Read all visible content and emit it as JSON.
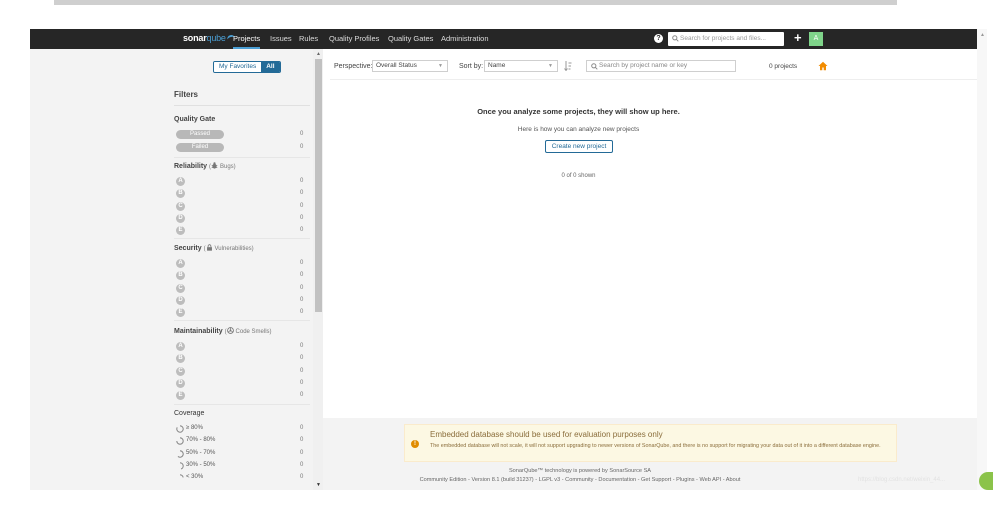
{
  "nav": {
    "logo_sonar": "sonar",
    "logo_qube": "qube",
    "items": [
      {
        "label": "Projects",
        "active": true
      },
      {
        "label": "Issues"
      },
      {
        "label": "Rules"
      },
      {
        "label": "Quality Profiles"
      },
      {
        "label": "Quality Gates"
      },
      {
        "label": "Administration"
      }
    ],
    "help_glyph": "?",
    "search_placeholder": "Search for projects and files...",
    "plus_glyph": "+",
    "avatar_letter": "A",
    "accent": "#4b9fd5",
    "avatar_color": "#7fd48a"
  },
  "sidebar": {
    "favorites": {
      "my": "My Favorites",
      "all": "All"
    },
    "filters_title": "Filters",
    "quality_gate": {
      "title": "Quality Gate",
      "items": [
        {
          "label": "Passed",
          "count": "0"
        },
        {
          "label": "Failed",
          "count": "0"
        }
      ]
    },
    "reliability": {
      "title": "Reliability",
      "open": "(",
      "icon": "bug-icon",
      "sub": "Bugs",
      "close": ")",
      "items": [
        {
          "label": "A",
          "count": "0"
        },
        {
          "label": "B",
          "count": "0"
        },
        {
          "label": "C",
          "count": "0"
        },
        {
          "label": "D",
          "count": "0"
        },
        {
          "label": "E",
          "count": "0"
        }
      ]
    },
    "security": {
      "title": "Security",
      "open": "(",
      "icon": "lock-icon",
      "sub": "Vulnerabilities",
      "close": ")",
      "items": [
        {
          "label": "A",
          "count": "0"
        },
        {
          "label": "B",
          "count": "0"
        },
        {
          "label": "C",
          "count": "0"
        },
        {
          "label": "D",
          "count": "0"
        },
        {
          "label": "E",
          "count": "0"
        }
      ]
    },
    "maintainability": {
      "title": "Maintainability",
      "open": "(",
      "icon": "code-smell-icon",
      "sub": "Code Smells",
      "close": ")",
      "items": [
        {
          "label": "A",
          "count": "0"
        },
        {
          "label": "B",
          "count": "0"
        },
        {
          "label": "C",
          "count": "0"
        },
        {
          "label": "D",
          "count": "0"
        },
        {
          "label": "E",
          "count": "0"
        }
      ]
    },
    "coverage": {
      "title": "Coverage",
      "items": [
        {
          "label": "≥ 80%",
          "count": "0"
        },
        {
          "label": "70% - 80%",
          "count": "0"
        },
        {
          "label": "50% - 70%",
          "count": "0"
        },
        {
          "label": "30% - 50%",
          "count": "0"
        },
        {
          "label": "< 30%",
          "count": "0"
        }
      ]
    }
  },
  "toolbar": {
    "perspective_label": "Perspective:",
    "perspective_value": "Overall Status",
    "sortby_label": "Sort by:",
    "sortby_value": "Name",
    "search_placeholder": "Search by project name or key",
    "projects_count": "0 projects",
    "home_color": "#f28c00"
  },
  "main": {
    "empty_title": "Once you analyze some projects, they will show up here.",
    "empty_sub": "Here is how you can analyze new projects",
    "create_button": "Create new project",
    "shown": "0 of 0 shown"
  },
  "warning": {
    "icon_glyph": "!",
    "title": "Embedded database should be used for evaluation purposes only",
    "text": "The embedded database will not scale, it will not support upgrading to newer versions of SonarQube, and there is no support for migrating your data out of it into a different database engine."
  },
  "footer": {
    "powered": "SonarQube™ technology is powered by SonarSource SA",
    "links": "Community Edition - Version 8.1 (build 31237) - LGPL v3 - Community - Documentation - Get Support - Plugins - Web API - About"
  },
  "watermark": "https://blog.csdn.net/weixin_44..."
}
